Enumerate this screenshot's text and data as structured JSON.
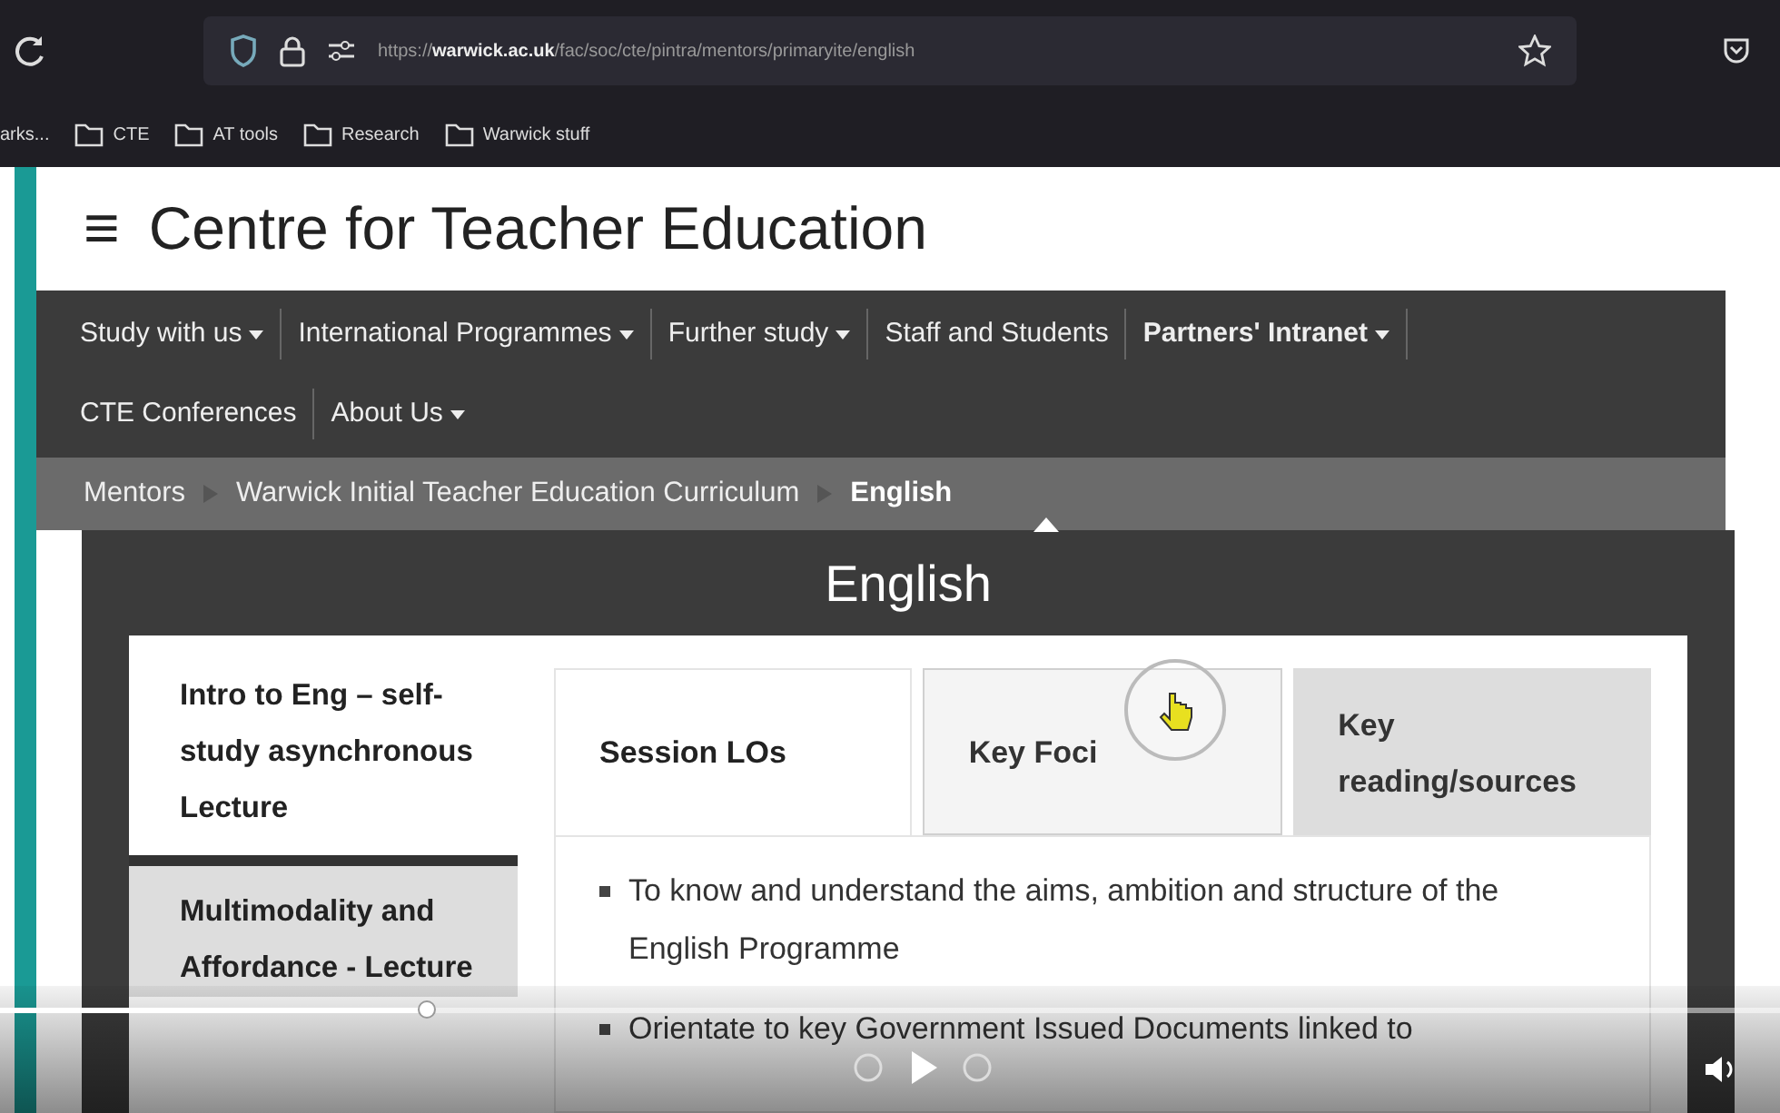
{
  "browser": {
    "url_scheme": "https://",
    "url_domain": "warwick.ac.uk",
    "url_path": "/fac/soc/cte/pintra/mentors/primaryite/english",
    "bookmarks": [
      {
        "label": "arks...",
        "kind": "text"
      },
      {
        "label": "CTE",
        "kind": "folder"
      },
      {
        "label": "AT tools",
        "kind": "folder"
      },
      {
        "label": "Research",
        "kind": "folder"
      },
      {
        "label": "Warwick stuff",
        "kind": "folder"
      }
    ]
  },
  "site": {
    "menu_icon": "≡",
    "title": "Centre for Teacher Education",
    "nav": [
      {
        "label": "Study with us",
        "dropdown": true,
        "bold": false
      },
      {
        "label": "International Programmes",
        "dropdown": true,
        "bold": false
      },
      {
        "label": "Further study",
        "dropdown": true,
        "bold": false
      },
      {
        "label": "Staff and Students",
        "dropdown": false,
        "bold": false
      },
      {
        "label": "Partners' Intranet",
        "dropdown": true,
        "bold": true
      },
      {
        "label": "CTE Conferences",
        "dropdown": false,
        "bold": false
      },
      {
        "label": "About Us",
        "dropdown": true,
        "bold": false
      }
    ],
    "breadcrumb": [
      {
        "label": "Mentors",
        "current": false
      },
      {
        "label": "Warwick Initial Teacher Education Curriculum",
        "current": false
      },
      {
        "label": "English",
        "current": true
      }
    ]
  },
  "page": {
    "heading": "English",
    "side_tabs": [
      {
        "label": "Intro to Eng – self-study asynchronous Lecture",
        "selected": true
      },
      {
        "label": "Multimodality and Affordance - Lecture",
        "selected": false
      }
    ],
    "tabs": [
      {
        "label": "Session LOs",
        "selected": true,
        "hovered": false
      },
      {
        "label": "Key Foci",
        "selected": false,
        "hovered": true
      },
      {
        "label": "Key reading/sources",
        "selected": false,
        "hovered": false
      }
    ],
    "bullets": [
      "To know and understand the aims, ambition and structure of the English Programme",
      "Orientate to key Government Issued Documents linked to"
    ]
  },
  "video": {
    "progress": {
      "level": 0.24
    }
  }
}
